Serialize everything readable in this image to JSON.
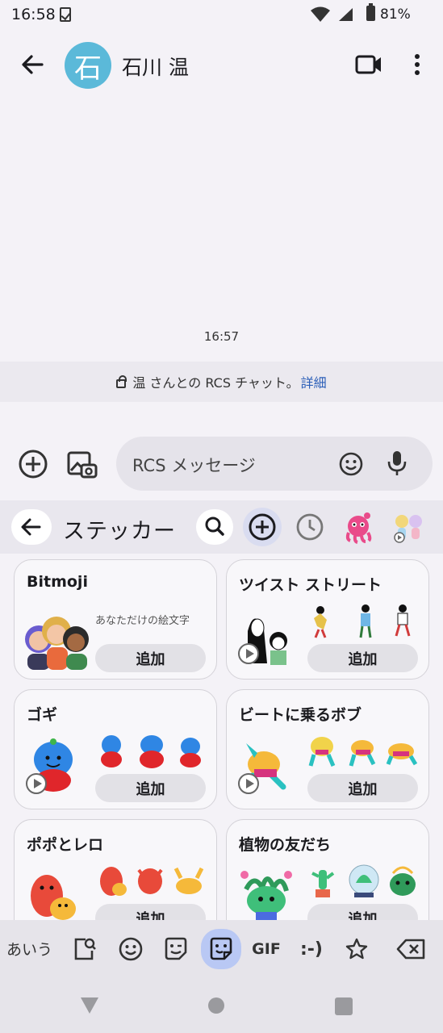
{
  "status_bar": {
    "time": "16:58",
    "battery": "81%"
  },
  "app_bar": {
    "avatar_initial": "石",
    "contact_name": "石川 温"
  },
  "conversation": {
    "timestamp": "16:57",
    "rcs_banner_text": "温 さんとの RCS チャット。",
    "rcs_banner_link": "詳細"
  },
  "compose": {
    "placeholder": "RCS メッセージ"
  },
  "sticker_panel": {
    "title": "ステッカー",
    "packs": [
      {
        "title": "Bitmoji",
        "subtitle": "あなただけの絵文字",
        "action": "追加"
      },
      {
        "title": "ツイスト ストリート",
        "action": "追加"
      },
      {
        "title": "ゴギ",
        "action": "追加"
      },
      {
        "title": "ビートに乗るボブ",
        "action": "追加"
      },
      {
        "title": "ポポとレロ",
        "action": "追加"
      },
      {
        "title": "植物の友だち",
        "action": "追加"
      }
    ]
  },
  "keyboard_toolbar": {
    "kana_label": "あいう",
    "gif_label": "GIF",
    "emoticon_label": ":-)"
  },
  "colors": {
    "avatar": "#5bb9d9",
    "link": "#2c5fb8",
    "active_tab": "#b9c8f4"
  }
}
